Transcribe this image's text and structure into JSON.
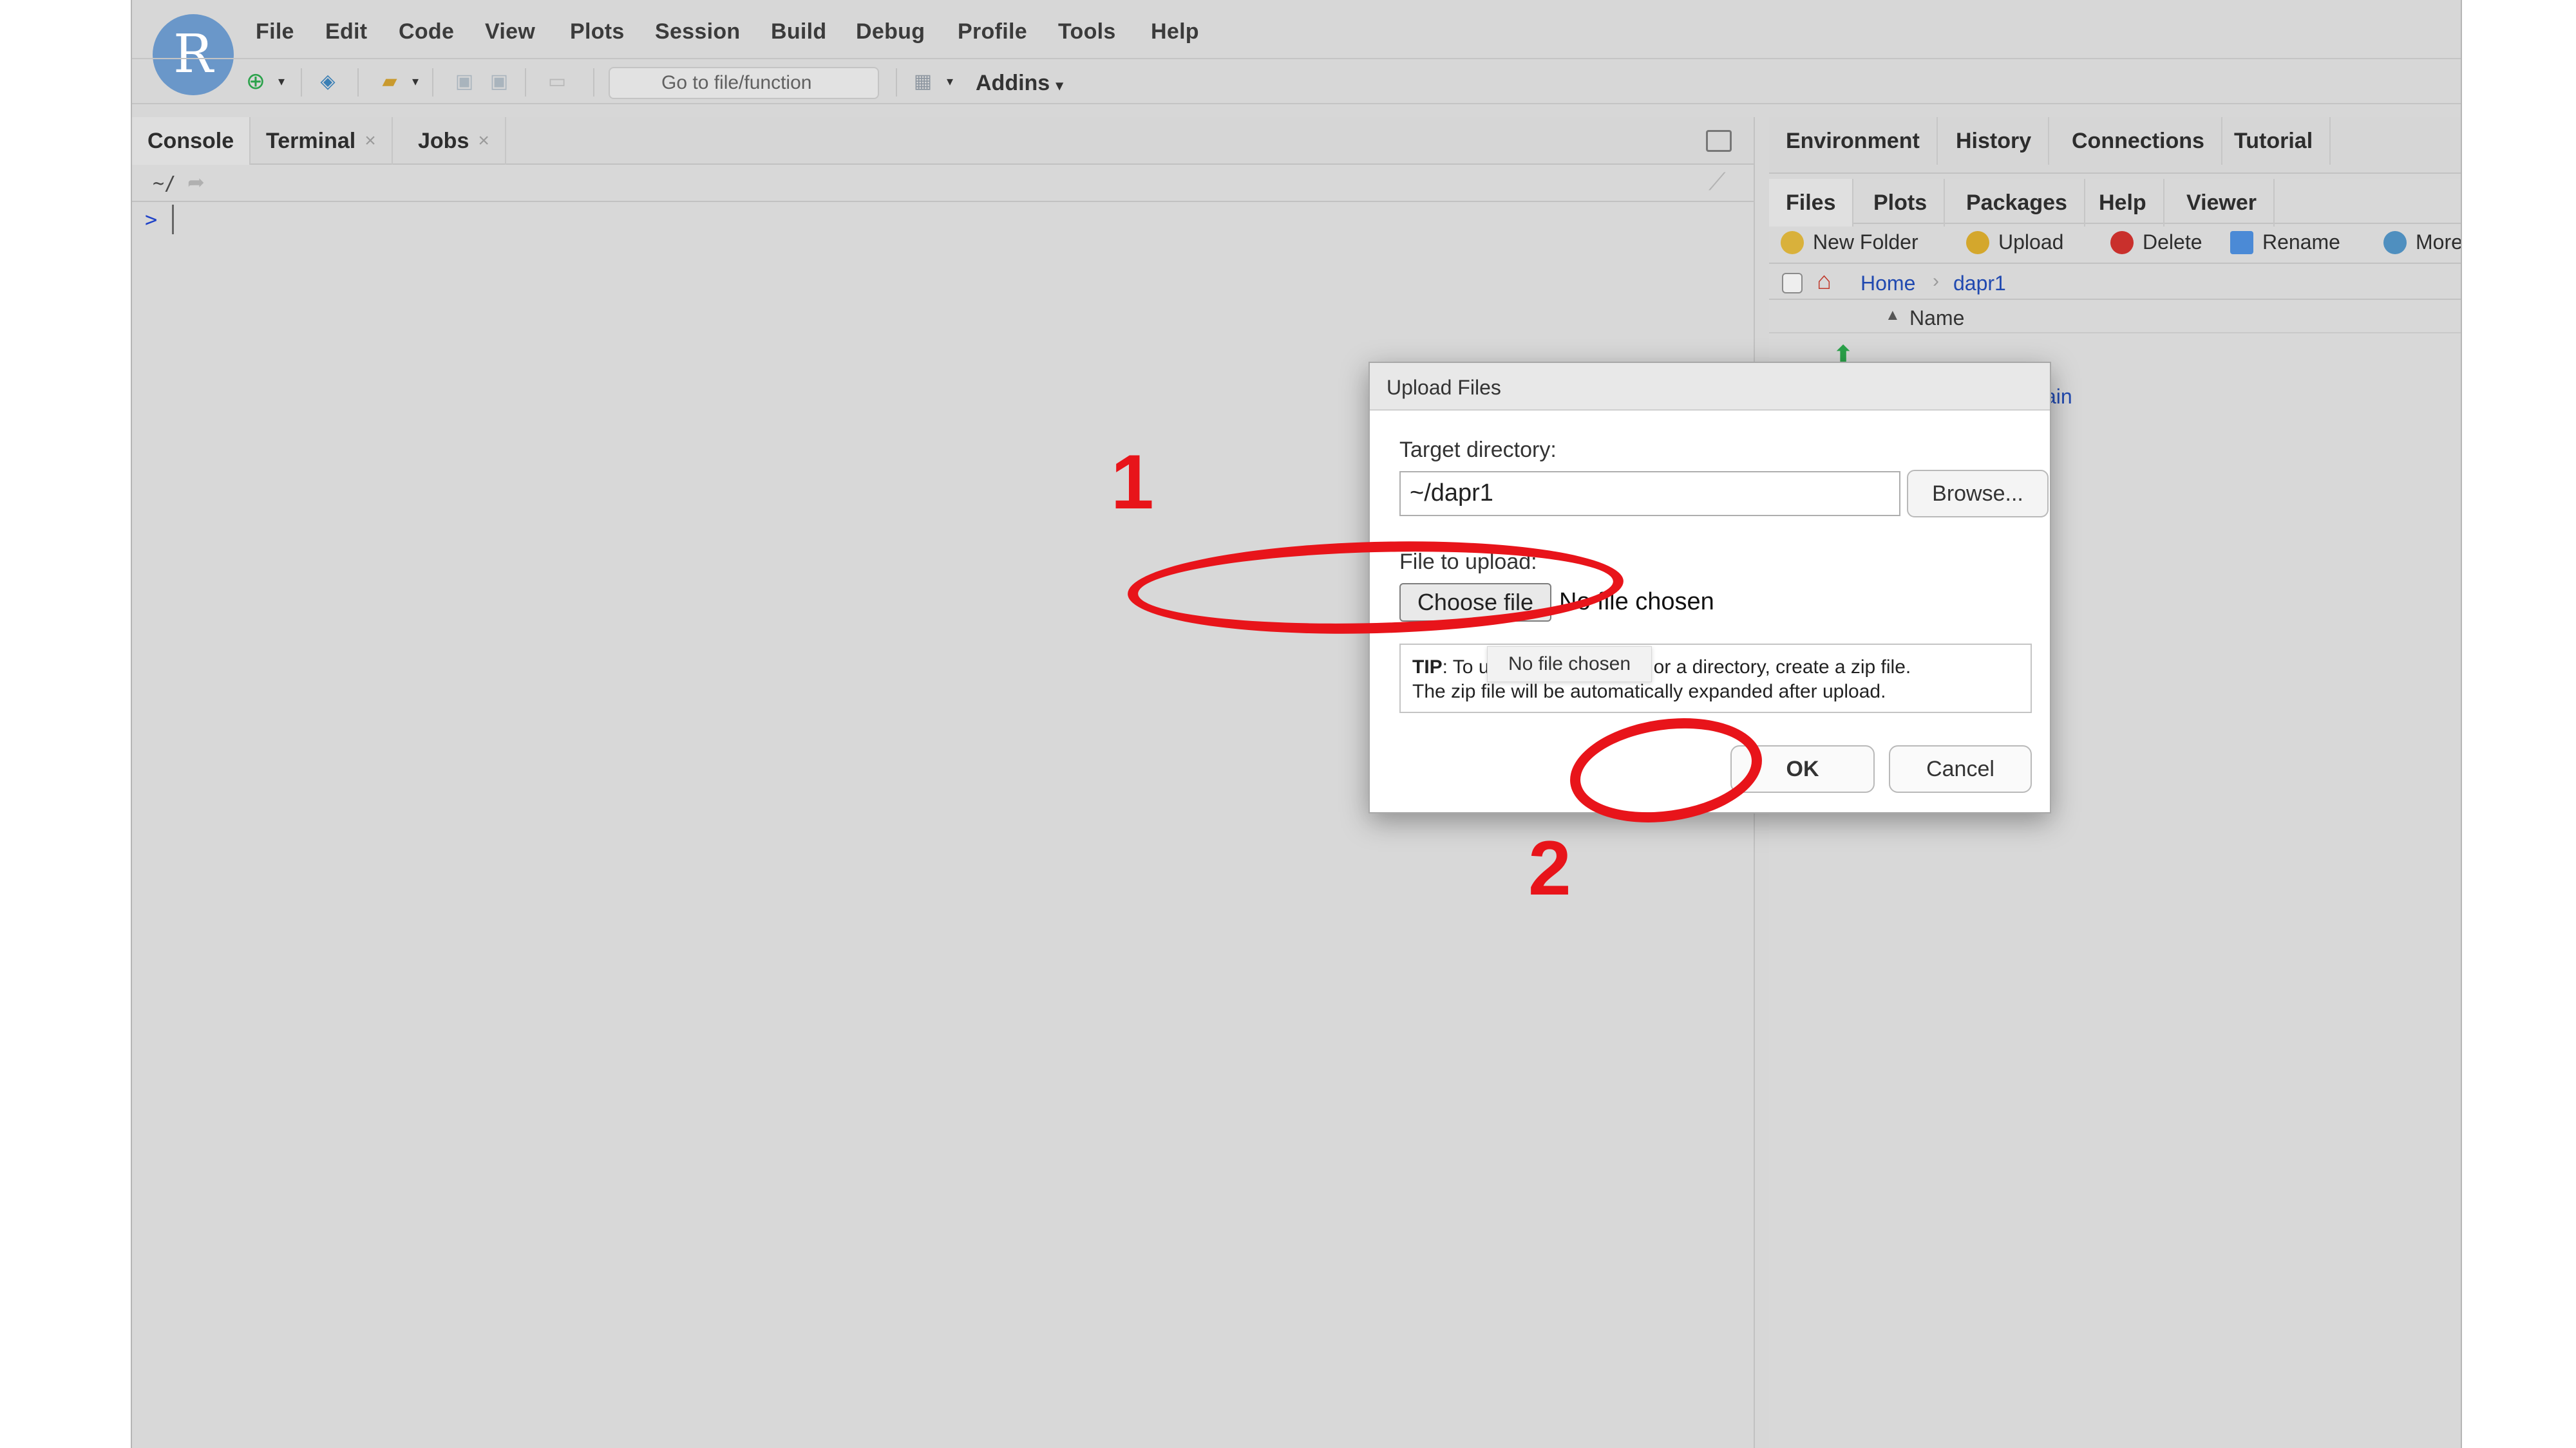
{
  "menu": [
    "File",
    "Edit",
    "Code",
    "View",
    "Plots",
    "Session",
    "Build",
    "Debug",
    "Profile",
    "Tools",
    "Help"
  ],
  "toolbar": {
    "goto_placeholder": "Go to file/function",
    "addins_label": "Addins"
  },
  "console": {
    "tabs": [
      {
        "label": "Console",
        "closable": false
      },
      {
        "label": "Terminal",
        "closable": true
      },
      {
        "label": "Jobs",
        "closable": true
      }
    ],
    "path": "~/",
    "prompt": ">"
  },
  "right_top": {
    "tabs": [
      "Environment",
      "History",
      "Connections",
      "Tutorial"
    ]
  },
  "files": {
    "tabs": [
      "Files",
      "Plots",
      "Packages",
      "Help",
      "Viewer"
    ],
    "toolbar": [
      "New Folder",
      "Upload",
      "Delete",
      "Rename",
      "More"
    ],
    "breadcrumb": [
      "Home",
      "dapr1"
    ],
    "column_name": "Name",
    "partial_row": "ain"
  },
  "dialog": {
    "title": "Upload Files",
    "target_label": "Target directory:",
    "target_value": "~/dapr1",
    "browse_label": "Browse...",
    "file_label": "File to upload:",
    "choose_label": "Choose file",
    "no_file": "No file chosen",
    "tip_bold": "TIP",
    "tip_line1": ": To upload multiple files or a directory, create a zip file.",
    "tip_line2": "The zip file will be automatically expanded after upload.",
    "tooltip": "No file chosen",
    "ok_label": "OK",
    "cancel_label": "Cancel"
  },
  "annotations": {
    "step1": "1",
    "step2": "2",
    "color": "#e8141a"
  }
}
